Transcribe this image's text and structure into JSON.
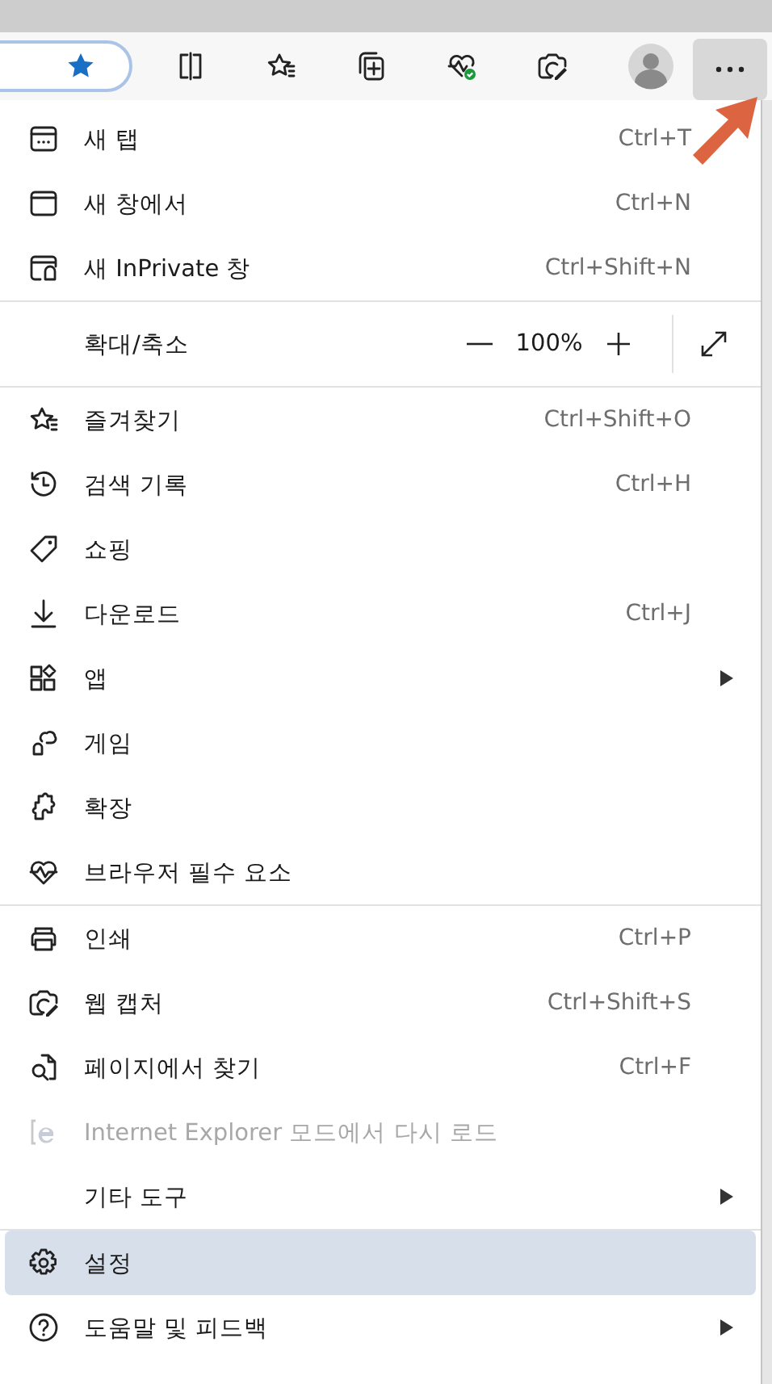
{
  "toolbar": {
    "favorite_saved": true,
    "more_button_active": true
  },
  "menu": [
    {
      "kind": "item",
      "label": "새 탭",
      "shortcut": "Ctrl+T",
      "submenu": false,
      "disabled": false,
      "highlighted": false
    },
    {
      "kind": "item",
      "label": "새 창에서",
      "shortcut": "Ctrl+N",
      "submenu": false,
      "disabled": false,
      "highlighted": false
    },
    {
      "kind": "item",
      "label": "새 InPrivate 창",
      "shortcut": "Ctrl+Shift+N",
      "submenu": false,
      "disabled": false,
      "highlighted": false
    },
    {
      "kind": "separator"
    },
    {
      "kind": "zoom",
      "label": "확대/축소",
      "value": "100%"
    },
    {
      "kind": "separator"
    },
    {
      "kind": "item",
      "label": "즐겨찾기",
      "shortcut": "Ctrl+Shift+O",
      "submenu": false,
      "disabled": false,
      "highlighted": false
    },
    {
      "kind": "item",
      "label": "검색 기록",
      "shortcut": "Ctrl+H",
      "submenu": false,
      "disabled": false,
      "highlighted": false
    },
    {
      "kind": "item",
      "label": "쇼핑",
      "submenu": false,
      "disabled": false,
      "highlighted": false
    },
    {
      "kind": "item",
      "label": "다운로드",
      "shortcut": "Ctrl+J",
      "submenu": false,
      "disabled": false,
      "highlighted": false
    },
    {
      "kind": "item",
      "label": "앱",
      "submenu": true,
      "disabled": false,
      "highlighted": false
    },
    {
      "kind": "item",
      "label": "게임",
      "submenu": false,
      "disabled": false,
      "highlighted": false
    },
    {
      "kind": "item",
      "label": "확장",
      "submenu": false,
      "disabled": false,
      "highlighted": false
    },
    {
      "kind": "item",
      "label": "브라우저 필수 요소",
      "submenu": false,
      "disabled": false,
      "highlighted": false
    },
    {
      "kind": "separator"
    },
    {
      "kind": "item",
      "label": "인쇄",
      "shortcut": "Ctrl+P",
      "submenu": false,
      "disabled": false,
      "highlighted": false
    },
    {
      "kind": "item",
      "label": "웹 캡처",
      "shortcut": "Ctrl+Shift+S",
      "submenu": false,
      "disabled": false,
      "highlighted": false
    },
    {
      "kind": "item",
      "label": "페이지에서 찾기",
      "shortcut": "Ctrl+F",
      "submenu": false,
      "disabled": false,
      "highlighted": false
    },
    {
      "kind": "item",
      "label": "Internet Explorer 모드에서 다시 로드",
      "submenu": false,
      "disabled": true,
      "highlighted": false
    },
    {
      "kind": "item",
      "label": "기타 도구",
      "submenu": true,
      "disabled": false,
      "highlighted": false
    },
    {
      "kind": "separator"
    },
    {
      "kind": "item",
      "label": "설정",
      "submenu": false,
      "disabled": false,
      "highlighted": true
    },
    {
      "kind": "item",
      "label": "도움말 및 피드백",
      "submenu": true,
      "disabled": false,
      "highlighted": false
    }
  ]
}
